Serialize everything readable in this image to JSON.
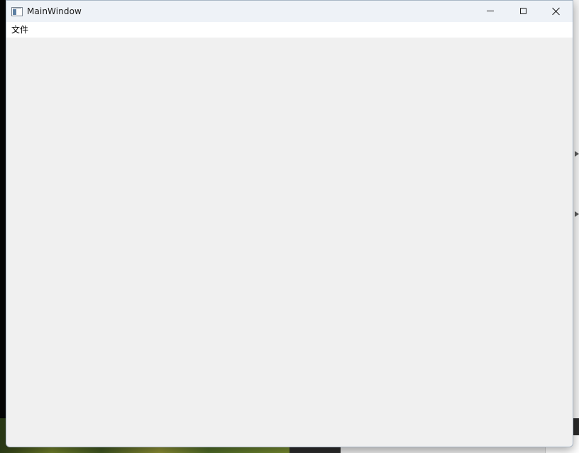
{
  "window": {
    "title": "MainWindow",
    "icon": "app-window-icon"
  },
  "caption_buttons": {
    "minimize_icon": "minimize-icon",
    "maximize_icon": "maximize-icon",
    "close_icon": "close-icon"
  },
  "menubar": {
    "items": [
      {
        "label": "文件"
      }
    ]
  },
  "colors": {
    "titlebar_bg": "#eef2f7",
    "menubar_bg": "#ffffff",
    "client_bg": "#f0f0f0",
    "window_border": "#a9b7c6"
  }
}
